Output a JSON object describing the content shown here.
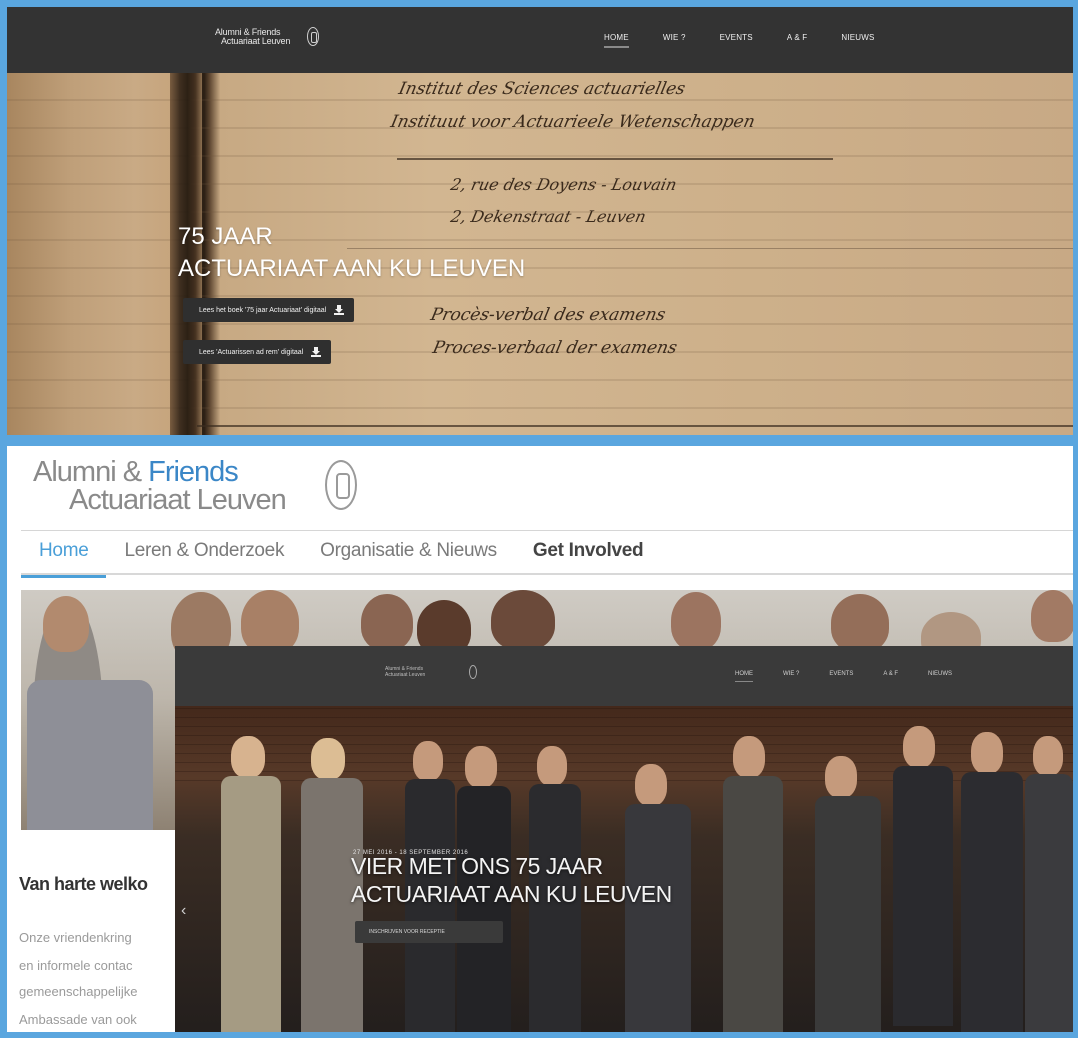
{
  "top": {
    "brand_line1": "Alumni & Friends",
    "brand_line2": "Actuariaat Leuven",
    "nav": [
      "HOME",
      "WIE ?",
      "EVENTS",
      "A & F",
      "NIEUWS"
    ],
    "hero_line1": "75 JAAR",
    "hero_line2": "ACTUARIAAT AAN KU LEUVEN",
    "button1": "Lees het boek '75 jaar Actuariaat' digitaal",
    "button2": "Lees 'Actuarissen ad rem' digitaal",
    "handwriting": [
      "Institut des Sciences actuarielles",
      "Instituut voor Actuarieele Wetenschappen",
      "2, rue des Doyens - Louvain",
      "2, Dekenstraat - Leuven",
      "Procès-verbal des examens",
      "Proces-verbaal der examens"
    ]
  },
  "bottom": {
    "logo_word1": "Alumni & ",
    "logo_word2": "Friends",
    "logo_line2": "Actuariaat Leuven",
    "tabs": [
      "Home",
      "Leren & Onderzoek",
      "Organisatie & Nieuws",
      "Get Involved"
    ],
    "welcome": "Van harte welko",
    "text_lines": [
      "Onze vriendenkring",
      "en informele contac",
      "gemeenschappelijke",
      "Ambassade van ook"
    ],
    "new_site": {
      "brand_line1": "Alumni & Friends",
      "brand_line2": "Actuariaat Leuven",
      "nav": [
        "HOME",
        "WIE ?",
        "EVENTS",
        "A & F",
        "NIEUWS"
      ],
      "title_line1": "VIER MET ONS 75 JAAR",
      "title_line2": "ACTUARIAAT AAN KU LEUVEN",
      "kicker": "27 MEI 2016 - 18 SEPTEMBER 2016",
      "button": "INSCHRIJVEN VOOR RECEPTIE"
    }
  },
  "colors": {
    "frame": "#5aa6df",
    "nav_dark": "#333333",
    "accent_blue": "#4a9fd8"
  }
}
